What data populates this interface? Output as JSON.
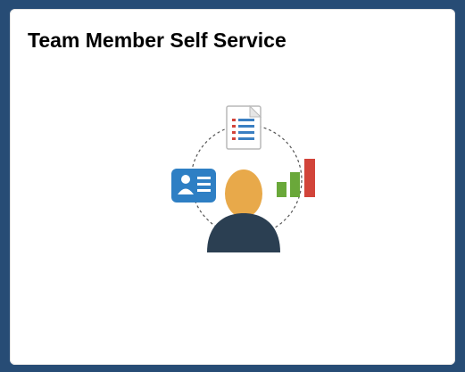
{
  "tile": {
    "title": "Team Member Self Service",
    "icon": "employee-self-service-icon"
  },
  "colors": {
    "page_background": "#274c75",
    "tile_background": "#ffffff",
    "person_head": "#e8a94a",
    "person_body": "#2b3f52",
    "id_card": "#2e7fc4",
    "bar_green": "#6aa83a",
    "bar_red": "#d2443a",
    "document_lines": "#3a7fc2"
  }
}
